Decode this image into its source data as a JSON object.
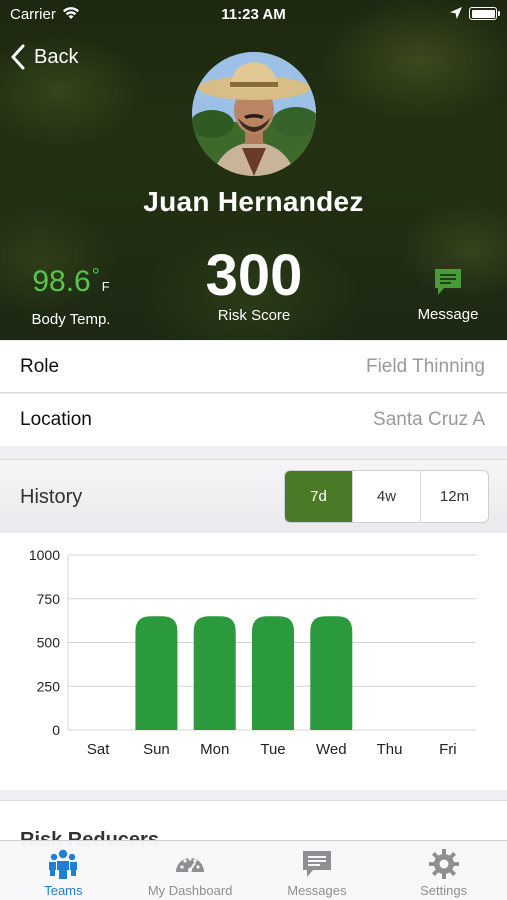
{
  "status_bar": {
    "carrier": "Carrier",
    "time": "11:23 AM"
  },
  "nav": {
    "back_label": "Back"
  },
  "profile": {
    "name": "Juan Hernandez",
    "body_temp_value": "98.6",
    "body_temp_degree": "°",
    "body_temp_unit": "F",
    "body_temp_label": "Body Temp.",
    "risk_score_value": "300",
    "risk_score_label": "Risk Score",
    "message_label": "Message"
  },
  "info": {
    "role_label": "Role",
    "role_value": "Field Thinning",
    "location_label": "Location",
    "location_value": "Santa Cruz A"
  },
  "history": {
    "title": "History",
    "ranges": [
      "7d",
      "4w",
      "12m"
    ],
    "selected_range": "7d"
  },
  "chart_data": {
    "type": "bar",
    "categories": [
      "Sat",
      "Sun",
      "Mon",
      "Tue",
      "Wed",
      "Thu",
      "Fri"
    ],
    "values": [
      0,
      650,
      650,
      650,
      650,
      0,
      0
    ],
    "yticks": [
      0,
      250,
      500,
      750,
      1000
    ],
    "ylim": [
      0,
      1000
    ],
    "grid": true,
    "bar_color": "#2a9a3c"
  },
  "risk_reducers": {
    "title": "Risk Reducers"
  },
  "tabbar": {
    "tabs": [
      {
        "label": "Teams",
        "icon": "teams-icon"
      },
      {
        "label": "My Dashboard",
        "icon": "dashboard-icon"
      },
      {
        "label": "Messages",
        "icon": "messages-icon"
      },
      {
        "label": "Settings",
        "icon": "settings-icon"
      }
    ],
    "active_index": 0
  },
  "colors": {
    "accent_green": "#4a7a28",
    "temp_green": "#56c64e",
    "tab_active_blue": "#1f7fd6"
  }
}
